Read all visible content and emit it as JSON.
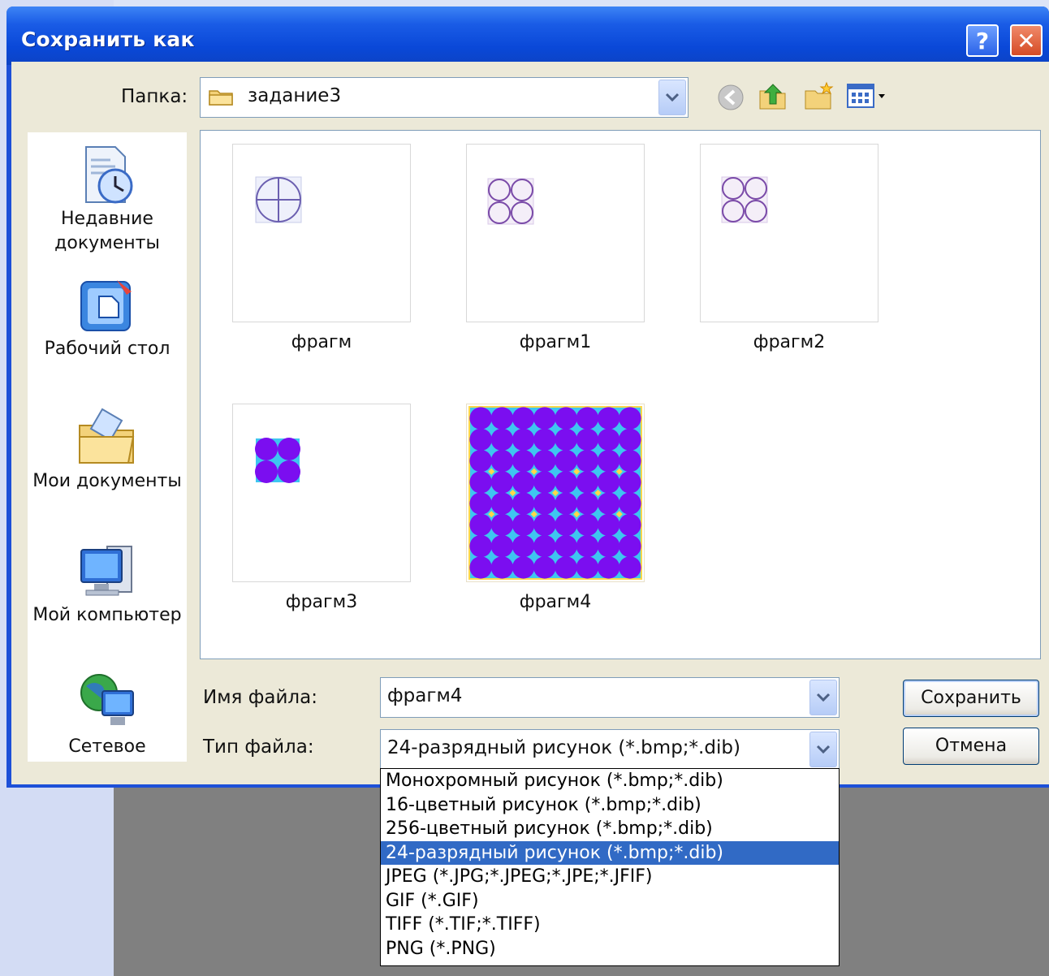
{
  "dialog": {
    "title": "Сохранить как",
    "help_label": "?",
    "close_label": "✕"
  },
  "folder": {
    "label": "Папка:",
    "value": "задание3",
    "toolbar_icons": [
      "back-icon",
      "up-folder-icon",
      "new-folder-icon",
      "view-menu-icon"
    ]
  },
  "places": [
    {
      "label": "Недавние документы",
      "icon": "recent-documents-icon"
    },
    {
      "label": "Рабочий стол",
      "icon": "desktop-icon"
    },
    {
      "label": "Мои документы",
      "icon": "my-documents-icon"
    },
    {
      "label": "Мой компьютер",
      "icon": "my-computer-icon"
    },
    {
      "label": "Сетевое",
      "icon": "network-icon"
    }
  ],
  "files": [
    {
      "name": "фрагм",
      "preview": "circle-cross"
    },
    {
      "name": "фрагм1",
      "preview": "four-circles"
    },
    {
      "name": "фрагм2",
      "preview": "four-circles"
    },
    {
      "name": "фрагм3",
      "preview": "small-colored-tile"
    },
    {
      "name": "фрагм4",
      "preview": "full-pattern"
    }
  ],
  "filename": {
    "label": "Имя файла:",
    "value": "фрагм4"
  },
  "filetype": {
    "label": "Тип файла:",
    "value": "24-разрядный рисунок (*.bmp;*.dib)",
    "options": [
      "Монохромный рисунок (*.bmp;*.dib)",
      "16-цветный рисунок (*.bmp;*.dib)",
      "256-цветный рисунок (*.bmp;*.dib)",
      "24-разрядный рисунок (*.bmp;*.dib)",
      "JPEG (*.JPG;*.JPEG;*.JPE;*.JFIF)",
      "GIF (*.GIF)",
      "TIFF (*.TIF;*.TIFF)",
      "PNG (*.PNG)"
    ],
    "selected_index": 3
  },
  "buttons": {
    "save": "Сохранить",
    "cancel": "Отмена"
  },
  "colors": {
    "title_blue": "#0a48d8",
    "selection": "#316ac5",
    "pattern_purple": "#7b0ef0",
    "pattern_cyan": "#3ec6f0",
    "pattern_yellow": "#ffd84a"
  }
}
